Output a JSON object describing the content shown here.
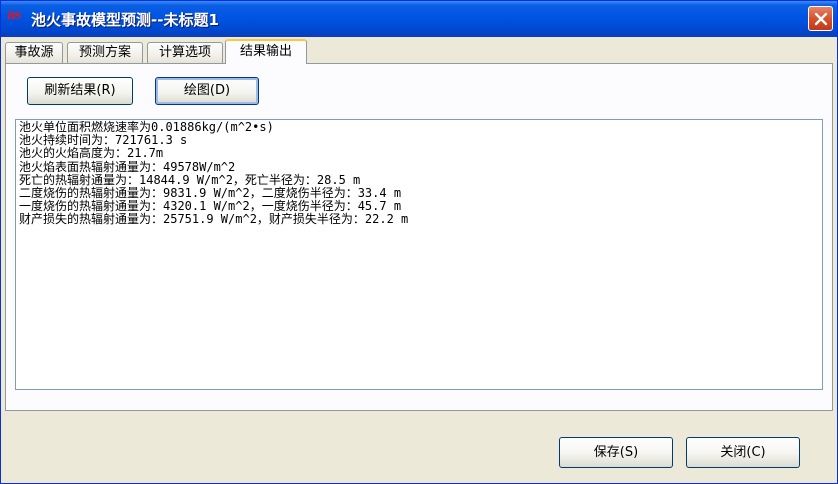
{
  "window": {
    "app_icon_text": "RS",
    "title": "池火事故模型预测--未标题1",
    "close_icon": "close-icon"
  },
  "tabs": [
    {
      "label": "事故源",
      "active": false
    },
    {
      "label": "预测方案",
      "active": false
    },
    {
      "label": "计算选项",
      "active": false
    },
    {
      "label": "结果输出",
      "active": true
    }
  ],
  "toolbar": {
    "refresh_label": "刷新结果(R)",
    "plot_label": "绘图(D)"
  },
  "output_lines": [
    "池火单位面积燃烧速率为0.01886kg/(m^2•s)",
    "池火持续时间为：721761.3 s",
    "池火的火焰高度为：21.7m",
    "池火焰表面热辐射通量为：49578W/m^2",
    "死亡的热辐射通量为：14844.9 W/m^2，死亡半径为：28.5 m",
    "二度烧伤的热辐射通量为：9831.9 W/m^2，二度烧伤半径为：33.4 m",
    "一度烧伤的热辐射通量为：4320.1 W/m^2，一度烧伤半径为：45.7 m",
    "财产损失的热辐射通量为：25751.9 W/m^2，财产损失半径为：22.2 m"
  ],
  "footer": {
    "save_label": "保存(S)",
    "close_label": "关闭(C)"
  },
  "colors": {
    "titlebar": "#0054e3",
    "close_button": "#d8522a",
    "active_tab_highlight": "#ffc83c",
    "face": "#ece9d8"
  }
}
